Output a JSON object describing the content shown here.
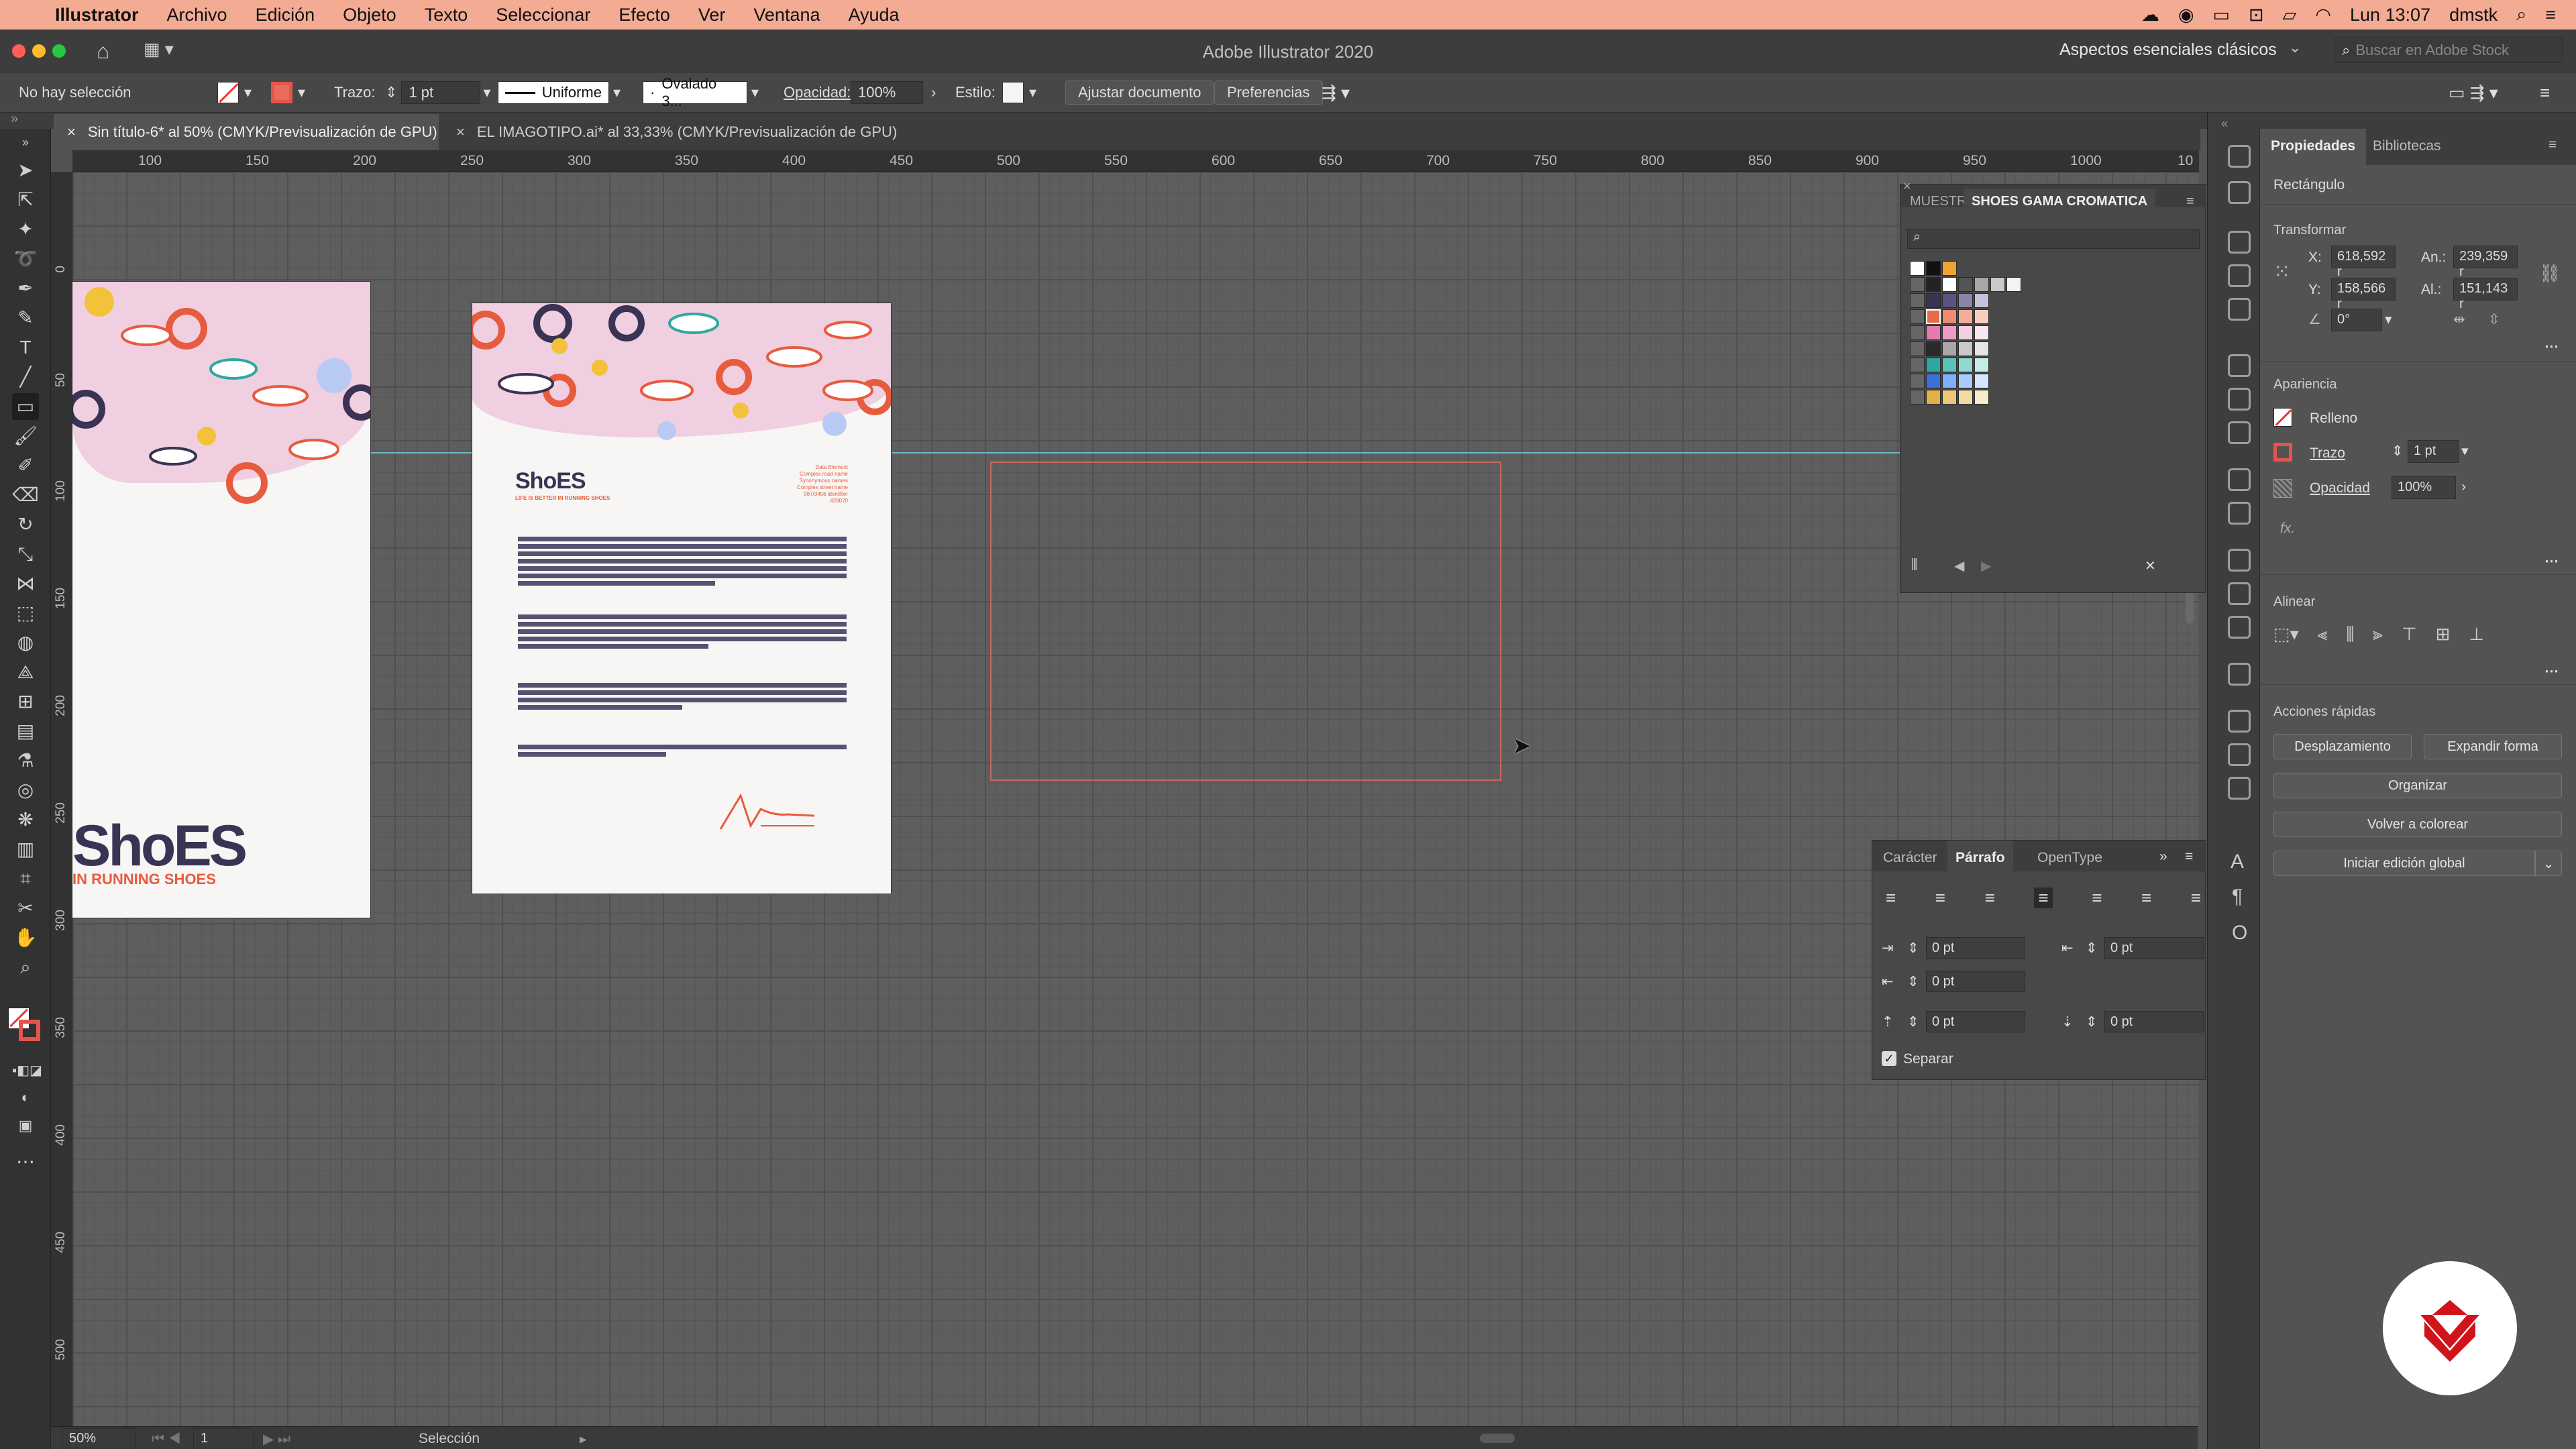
{
  "menubar": {
    "app": "Illustrator",
    "items": [
      "Archivo",
      "Edición",
      "Objeto",
      "Texto",
      "Seleccionar",
      "Efecto",
      "Ver",
      "Ventana",
      "Ayuda"
    ],
    "clock": "Lun 13:07",
    "user": "dmstk"
  },
  "window": {
    "title": "Adobe Illustrator 2020",
    "workspace": "Aspectos esenciales clásicos",
    "search_placeholder": "Buscar en Adobe Stock"
  },
  "control": {
    "selection": "No hay selección",
    "stroke_label": "Trazo:",
    "stroke_value": "1 pt",
    "stroke_style": "Uniforme",
    "brush": "Ovalado 3...",
    "opacity_label": "Opacidad:",
    "opacity_value": "100%",
    "style_label": "Estilo:",
    "fit_doc": "Ajustar documento",
    "prefs": "Preferencias"
  },
  "tabs": [
    {
      "label": "Sin título-6* al 50% (CMYK/Previsualización de GPU)",
      "active": true
    },
    {
      "label": "EL IMAGOTIPO.ai* al 33,33% (CMYK/Previsualización de GPU)",
      "active": false
    }
  ],
  "ruler": {
    "top": [
      "100",
      "150",
      "200",
      "250",
      "300",
      "350",
      "400",
      "450",
      "500",
      "550",
      "600",
      "650",
      "700",
      "750",
      "800",
      "850",
      "900",
      "950",
      "1000",
      "10"
    ],
    "left": [
      "0",
      "50",
      "100",
      "150",
      "200",
      "250",
      "300",
      "350",
      "400",
      "450",
      "500"
    ]
  },
  "artboard1": {
    "brand": "ShoES",
    "tag": "IN RUNNING SHOES"
  },
  "artboard2": {
    "brand": "ShoES",
    "tag": "LIFE IS BETTER IN RUNNING SHOES",
    "address": [
      "Data Element",
      "Complex road name",
      "Synonymous names",
      "Complex street name",
      "987/3456 identifier",
      "428070"
    ]
  },
  "status": {
    "zoom": "50%",
    "page": "1",
    "tool": "Selección"
  },
  "swatches": {
    "tab_other": "MUESTR",
    "tab_active": "SHOES GAMA CROMATICA",
    "colors": [
      "#ffffff",
      "#111111",
      "#f1a434",
      "#232323",
      "#f3f3f3",
      "#3a3353",
      "#e76a4a",
      "#f0d0e0",
      "#2da8a0",
      "#7cb0ff",
      "#e2b24a",
      "#c9c9c9",
      "#a7a7a7"
    ]
  },
  "paragraph": {
    "tabs": [
      "Carácter",
      "Párrafo",
      "OpenType"
    ],
    "fields": [
      "0 pt",
      "0 pt",
      "0 pt",
      "0 pt",
      "0 pt"
    ],
    "hyphen": "Separar"
  },
  "properties": {
    "tabs": [
      "Propiedades",
      "Bibliotecas"
    ],
    "object": "Rectángulo",
    "transform": "Transformar",
    "x_label": "X:",
    "x": "618,592 r",
    "y_label": "Y:",
    "y": "158,566 r",
    "w_label": "An.:",
    "w": "239,359 r",
    "h_label": "Al.:",
    "h": "151,143 r",
    "angle": "0°",
    "appearance": "Apariencia",
    "fill": "Relleno",
    "stroke": "Trazo",
    "stroke_val": "1 pt",
    "opacity": "Opacidad",
    "opacity_val": "100%",
    "fx": "fx.",
    "align": "Alinear",
    "quick": "Acciones rápidas",
    "btn_offset": "Desplazamiento",
    "btn_expand": "Expandir forma",
    "btn_arrange": "Organizar",
    "btn_recolor": "Volver a colorear",
    "btn_global": "Iniciar edición global"
  }
}
